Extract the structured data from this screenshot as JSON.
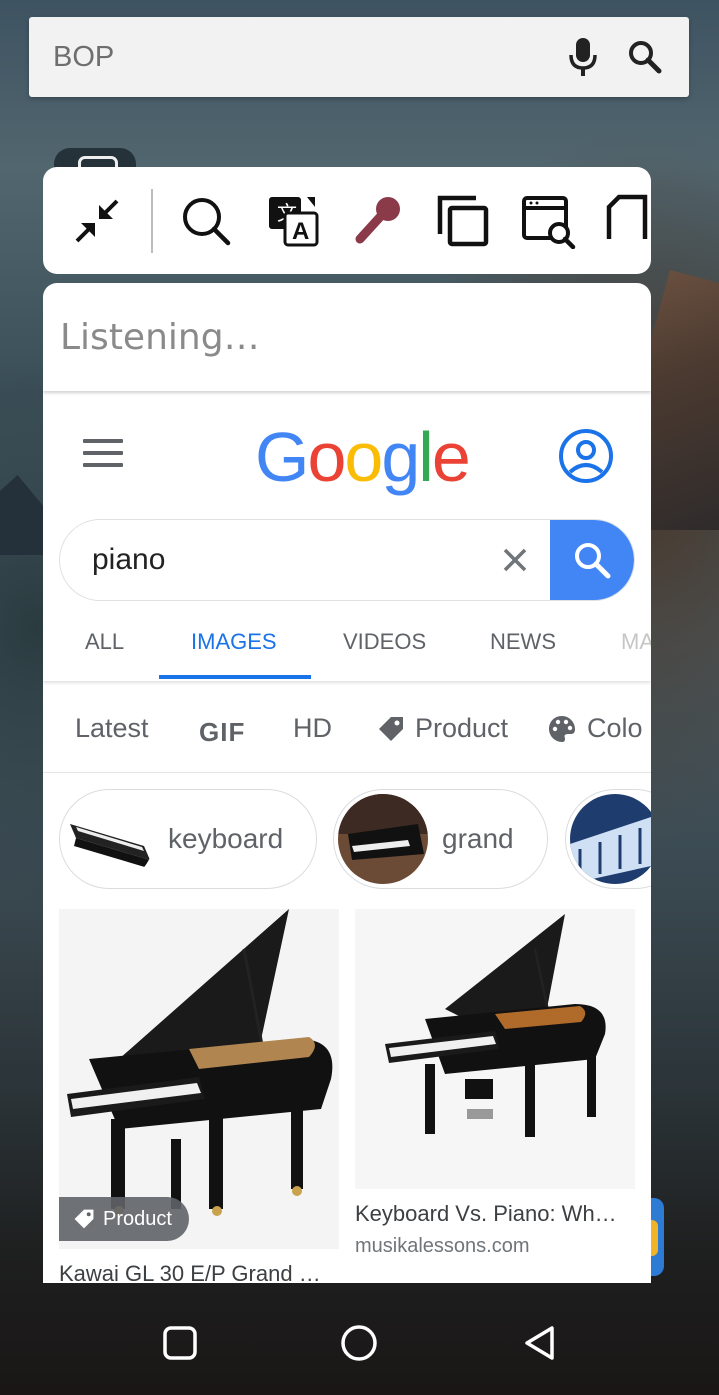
{
  "top_search": {
    "query": "BOP"
  },
  "listening_text": "Listening…",
  "google": {
    "logo_letters": [
      "G",
      "o",
      "o",
      "g",
      "l",
      "e"
    ],
    "search_value": "piano",
    "tabs": [
      {
        "label": "ALL",
        "active": false
      },
      {
        "label": "IMAGES",
        "active": true
      },
      {
        "label": "VIDEOS",
        "active": false
      },
      {
        "label": "NEWS",
        "active": false
      },
      {
        "label": "MA",
        "active": false
      }
    ],
    "filters": [
      "Latest",
      "GIF",
      "HD",
      "Product",
      "Colo"
    ],
    "chips": [
      {
        "label": "keyboard"
      },
      {
        "label": "grand"
      },
      {
        "label": ""
      }
    ],
    "results": [
      {
        "title": "Kawai GL 30 E/P Grand …",
        "site": "",
        "badge": "Product"
      },
      {
        "title": "Keyboard Vs. Piano: Wh…",
        "site": "musikalessons.com",
        "badge": ""
      }
    ]
  },
  "colors": {
    "google_blue": "#4285F4",
    "google_red": "#EA4335",
    "google_yellow": "#FBBC05",
    "google_green": "#34A853",
    "link_blue": "#1A73E8",
    "mic_accent": "#8B3A4A"
  },
  "icons": [
    "collapse-icon",
    "search-icon",
    "translate-icon",
    "microphone-icon",
    "copy-icon",
    "web-search-icon",
    "screenshot-icon",
    "menu-icon",
    "account-icon",
    "clear-icon",
    "tag-icon",
    "palette-icon",
    "recents-icon",
    "home-icon",
    "back-icon"
  ]
}
